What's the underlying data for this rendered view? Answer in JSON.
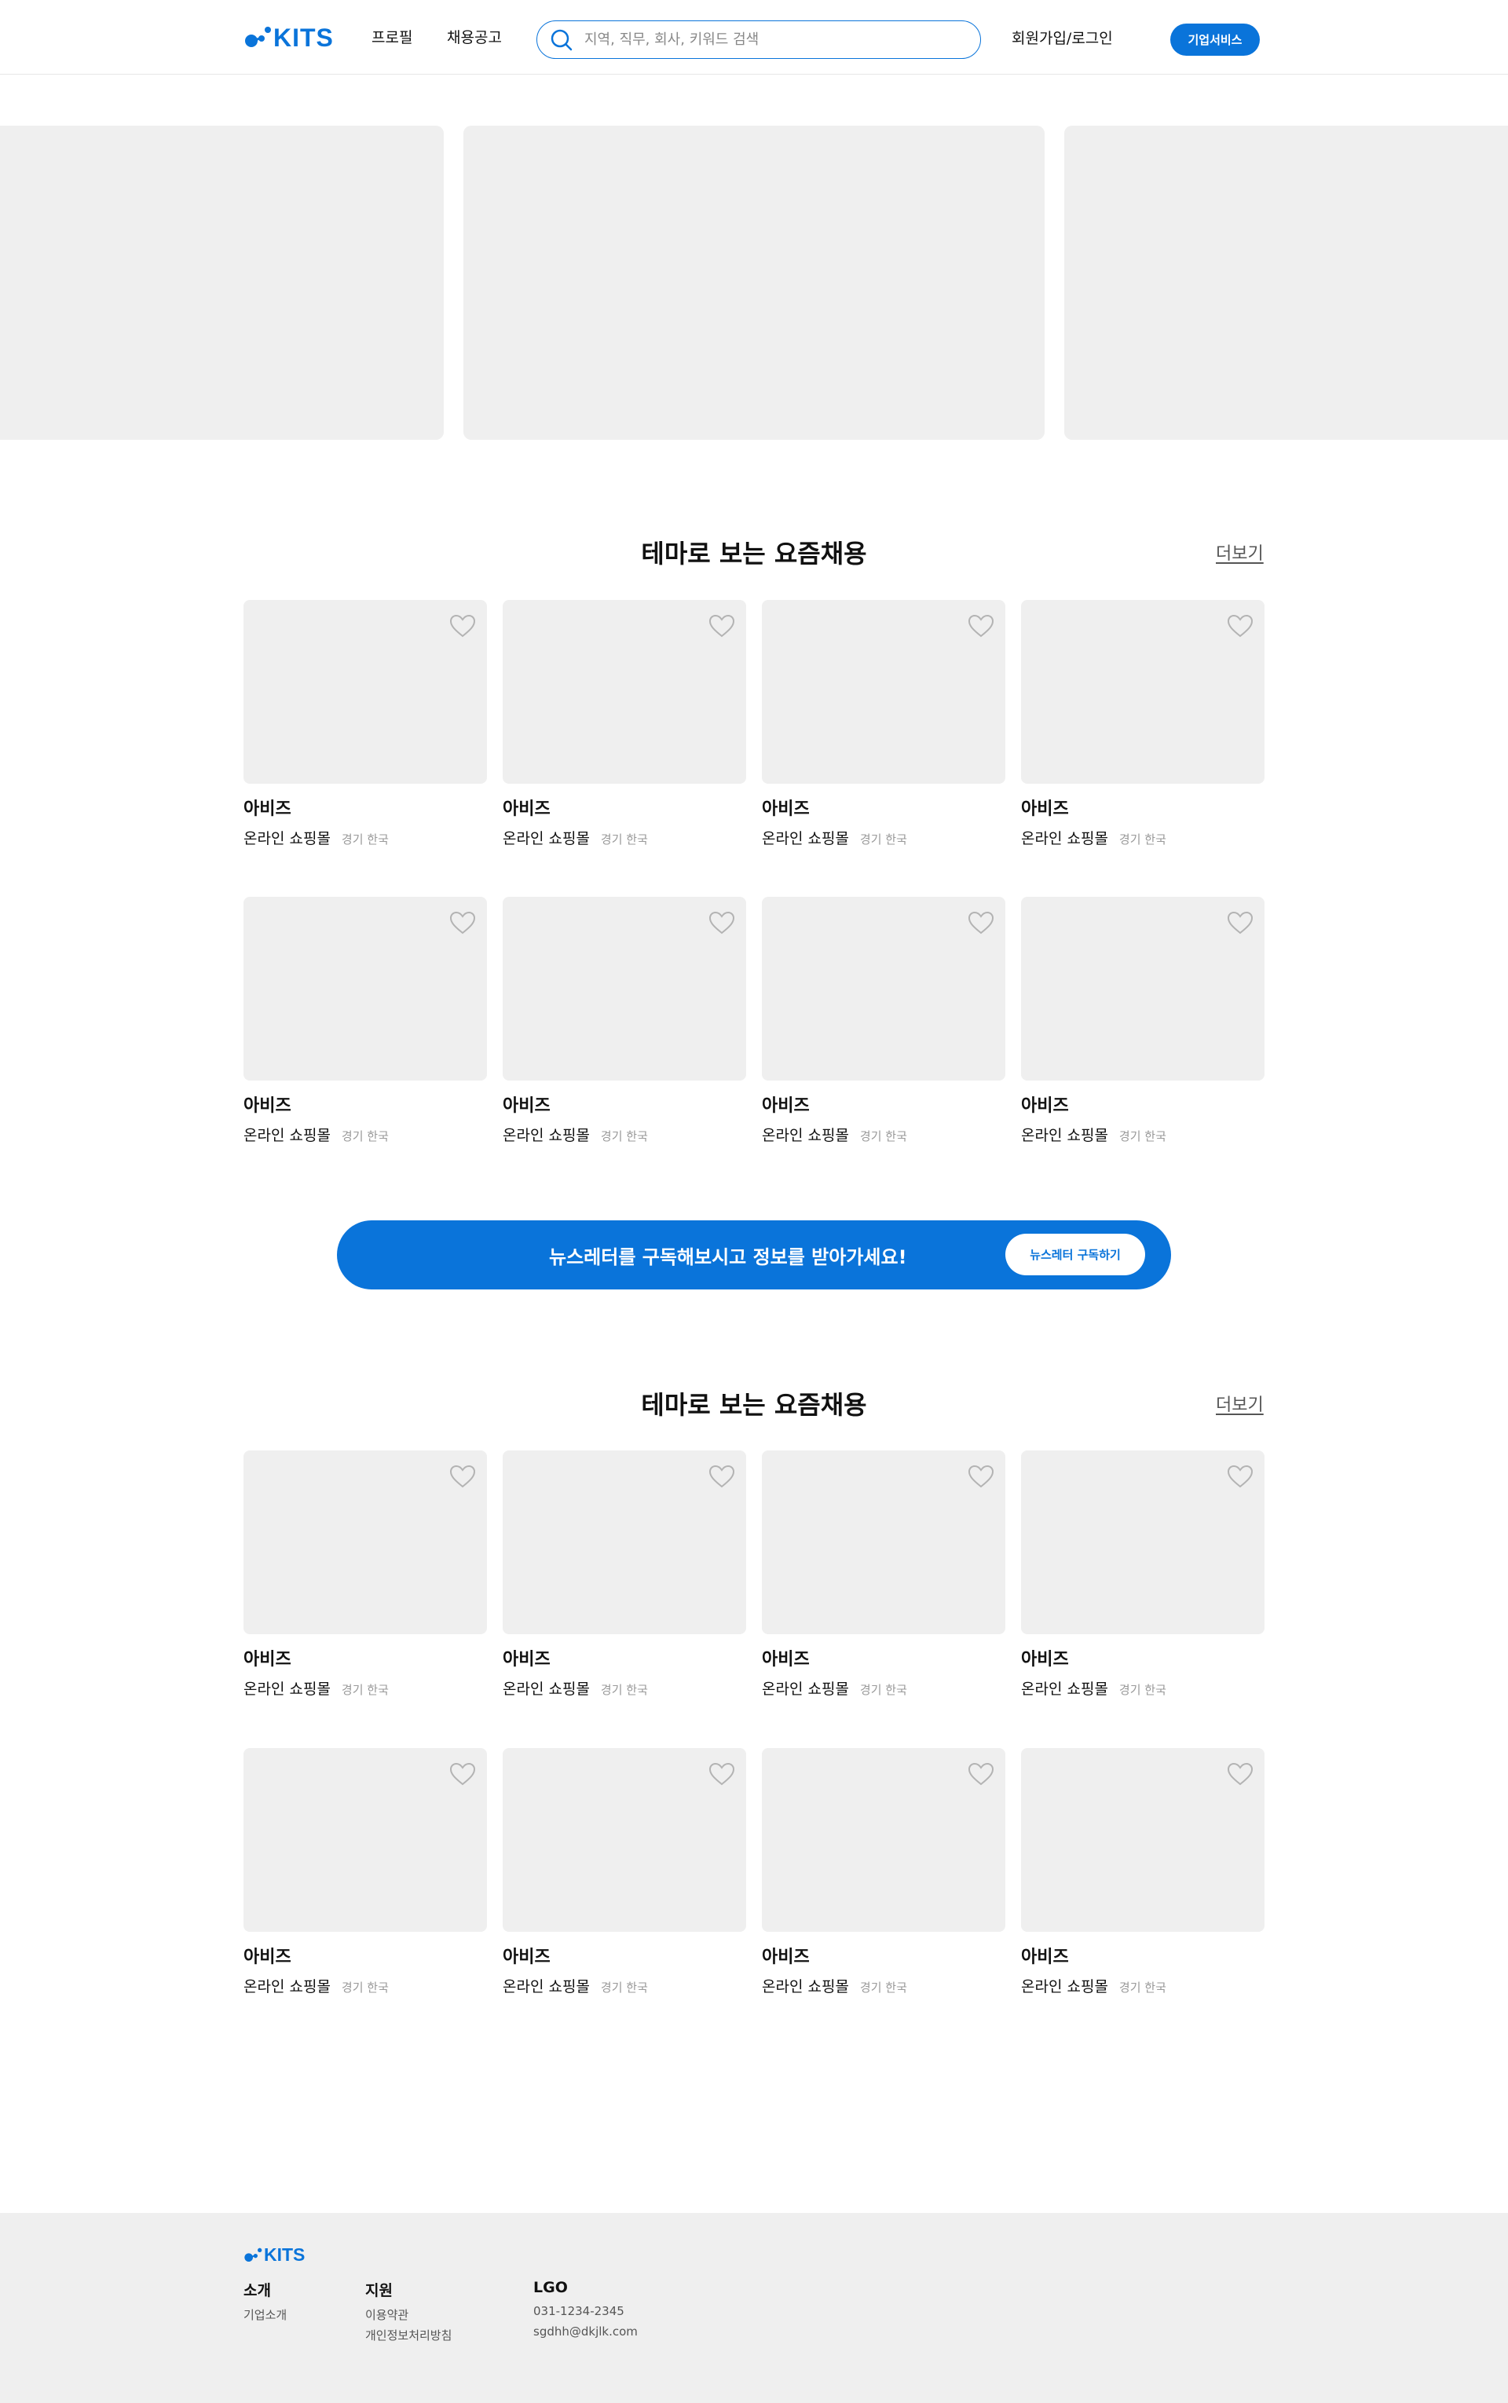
{
  "header": {
    "logo_text": "KITS",
    "nav": [
      {
        "label": "프로필"
      },
      {
        "label": "채용공고"
      }
    ],
    "search_placeholder": "지역, 직무, 회사, 키워드 검색",
    "login_label": "회원가입/로그인",
    "business_label": "기업서비스"
  },
  "sections": [
    {
      "title": "테마로 보는 요즘채용",
      "more_label": "더보기",
      "cards": [
        {
          "name": "아비즈",
          "category": "온라인 쇼핑몰",
          "location": "경기 한국"
        },
        {
          "name": "아비즈",
          "category": "온라인 쇼핑몰",
          "location": "경기 한국"
        },
        {
          "name": "아비즈",
          "category": "온라인 쇼핑몰",
          "location": "경기 한국"
        },
        {
          "name": "아비즈",
          "category": "온라인 쇼핑몰",
          "location": "경기 한국"
        },
        {
          "name": "아비즈",
          "category": "온라인 쇼핑몰",
          "location": "경기 한국"
        },
        {
          "name": "아비즈",
          "category": "온라인 쇼핑몰",
          "location": "경기 한국"
        },
        {
          "name": "아비즈",
          "category": "온라인 쇼핑몰",
          "location": "경기 한국"
        },
        {
          "name": "아비즈",
          "category": "온라인 쇼핑몰",
          "location": "경기 한국"
        }
      ]
    },
    {
      "title": "테마로 보는 요즘채용",
      "more_label": "더보기",
      "cards": [
        {
          "name": "아비즈",
          "category": "온라인 쇼핑몰",
          "location": "경기 한국"
        },
        {
          "name": "아비즈",
          "category": "온라인 쇼핑몰",
          "location": "경기 한국"
        },
        {
          "name": "아비즈",
          "category": "온라인 쇼핑몰",
          "location": "경기 한국"
        },
        {
          "name": "아비즈",
          "category": "온라인 쇼핑몰",
          "location": "경기 한국"
        },
        {
          "name": "아비즈",
          "category": "온라인 쇼핑몰",
          "location": "경기 한국"
        },
        {
          "name": "아비즈",
          "category": "온라인 쇼핑몰",
          "location": "경기 한국"
        },
        {
          "name": "아비즈",
          "category": "온라인 쇼핑몰",
          "location": "경기 한국"
        },
        {
          "name": "아비즈",
          "category": "온라인 쇼핑몰",
          "location": "경기 한국"
        }
      ]
    }
  ],
  "newsletter": {
    "text": "뉴스레터를 구독해보시고 정보를 받아가세요!",
    "button_label": "뉴스레터 구독하기"
  },
  "footer": {
    "logo_text": "KITS",
    "columns": [
      {
        "heading": "소개",
        "items": [
          "기업소개"
        ]
      },
      {
        "heading": "지원",
        "items": [
          "이용약관",
          "개인정보처리방침"
        ]
      },
      {
        "heading": "LGO",
        "items": [
          "031-1234-2345",
          "sgdhh@dkjlk.com"
        ]
      }
    ]
  },
  "colors": {
    "brand_blue": "#0a74da",
    "placeholder_gray": "#efefef"
  },
  "icons": [
    "search-icon",
    "heart-icon",
    "logo-mark-icon"
  ]
}
